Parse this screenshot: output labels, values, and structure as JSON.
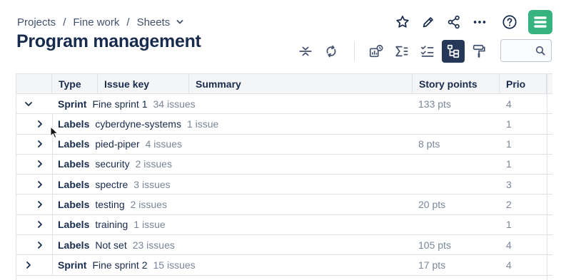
{
  "breadcrumb": {
    "items": [
      "Projects",
      "Fine work",
      "Sheets"
    ],
    "separator": "/"
  },
  "page_title": "Program management",
  "top_actions": [
    "star-icon",
    "pencil-icon",
    "share-icon",
    "more-icon",
    "help-icon",
    "app-logo"
  ],
  "toolbar": [
    "collapse-rows-icon",
    "refresh-icon",
    "chart-icon",
    "sum-icon",
    "checklist-icon",
    "hierarchy-icon",
    "paint-roller-icon"
  ],
  "search": {
    "value": "",
    "placeholder": ""
  },
  "colors": {
    "accent": "#253858",
    "logo": "#36b37e",
    "muted_text": "#7a869a",
    "grid_line": "#dfe1e6",
    "header_bg": "#f4f5f7"
  },
  "columns": [
    "Type",
    "Issue key",
    "Summary",
    "Story points",
    "Prio"
  ],
  "groups": [
    {
      "kind": "Sprint",
      "value": "Fine sprint 1",
      "count": "34 issues",
      "points": "133 pts",
      "prio": "4",
      "level": 0,
      "expanded": true
    },
    {
      "kind": "Labels",
      "value": "cyberdyne-systems",
      "count": "1 issue",
      "points": "",
      "prio": "1",
      "level": 1,
      "expanded": false
    },
    {
      "kind": "Labels",
      "value": "pied-piper",
      "count": "4 issues",
      "points": "8 pts",
      "prio": "1",
      "level": 1,
      "expanded": false
    },
    {
      "kind": "Labels",
      "value": "security",
      "count": "2 issues",
      "points": "",
      "prio": "1",
      "level": 1,
      "expanded": false
    },
    {
      "kind": "Labels",
      "value": "spectre",
      "count": "3 issues",
      "points": "",
      "prio": "3",
      "level": 1,
      "expanded": false
    },
    {
      "kind": "Labels",
      "value": "testing",
      "count": "2 issues",
      "points": "20 pts",
      "prio": "2",
      "level": 1,
      "expanded": false
    },
    {
      "kind": "Labels",
      "value": "training",
      "count": "1 issue",
      "points": "",
      "prio": "1",
      "level": 1,
      "expanded": false
    },
    {
      "kind": "Labels",
      "value": "Not set",
      "count": "23 issues",
      "points": "105 pts",
      "prio": "4",
      "level": 1,
      "expanded": false
    },
    {
      "kind": "Sprint",
      "value": "Fine sprint 2",
      "count": "15 issues",
      "points": "17 pts",
      "prio": "4",
      "level": 0,
      "expanded": false
    }
  ]
}
